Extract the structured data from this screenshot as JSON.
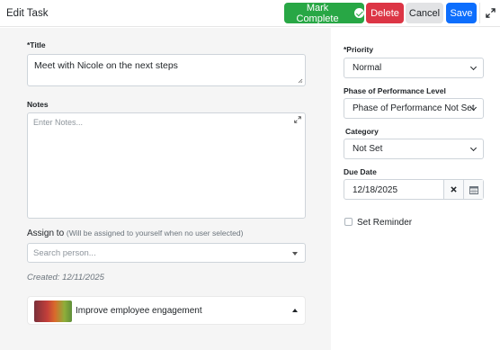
{
  "header": {
    "title": "Edit Task",
    "mark_complete_label": "Mark Complete",
    "delete_label": "Delete",
    "cancel_label": "Cancel",
    "save_label": "Save"
  },
  "form": {
    "title_label": "*Title",
    "title_value": "Meet with Nicole on the next steps",
    "notes_label": "Notes",
    "notes_placeholder": "Enter Notes...",
    "assign_label": "Assign to",
    "assign_hint": "(Will be assigned to yourself when no user selected)",
    "assign_placeholder": "Search person...",
    "created_text": "Created: 12/11/2025",
    "goal_label": "Improve employee engagement"
  },
  "side": {
    "priority_label": "*Priority",
    "priority_value": "Normal",
    "phase_label": "Phase of Performance Level",
    "phase_value": "Phase of Performance Not Set",
    "category_label": "Category",
    "category_value": "Not Set",
    "due_label": "Due Date",
    "due_value": "12/18/2025",
    "reminder_label": "Set Reminder",
    "reminder_checked": false
  },
  "colors": {
    "complete": "#28a745",
    "delete": "#dc3545",
    "cancel": "#e2e3e5",
    "save": "#0d6efd",
    "left_panel_bg": "#f5f5f5"
  },
  "icons": [
    "check-circle-icon",
    "expand-icon",
    "resize-icon",
    "caret-down-icon",
    "chevron-down-icon",
    "clear-icon",
    "calendar-icon",
    "caret-up-icon"
  ]
}
